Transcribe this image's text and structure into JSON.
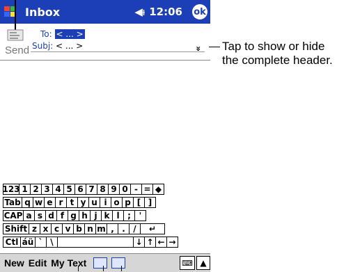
{
  "titlebar": {
    "app_title": "Inbox",
    "speaker_icon": "◀ᵼ",
    "time": "12:06",
    "ok_label": "ok"
  },
  "header": {
    "send_label": "Send",
    "to_label": "To:",
    "to_value": "< ... >",
    "subj_label": "Subj:",
    "subj_value": "< ... >",
    "toggle_glyph": "»"
  },
  "callout": {
    "line1": "Tap to show or hide",
    "line2": "the complete header."
  },
  "keyboard": {
    "rows": [
      [
        "123",
        "1",
        "2",
        "3",
        "4",
        "5",
        "6",
        "7",
        "8",
        "9",
        "0",
        "-",
        "=",
        "◆"
      ],
      [
        "Tab",
        "q",
        "w",
        "e",
        "r",
        "t",
        "y",
        "u",
        "i",
        "o",
        "p",
        "[",
        "]"
      ],
      [
        "CAP",
        "a",
        "s",
        "d",
        "f",
        "g",
        "h",
        "j",
        "k",
        "l",
        ";",
        "'"
      ],
      [
        "Shift",
        "z",
        "x",
        "c",
        "v",
        "b",
        "n",
        "m",
        ",",
        ".",
        "/",
        "↵"
      ],
      [
        "Ctl",
        "áü",
        "`",
        "\\",
        " ",
        "↓",
        "↑",
        "←",
        "→"
      ]
    ]
  },
  "menubar": {
    "new": "New",
    "edit": "Edit",
    "mytext": "My Text",
    "arrow": "▲"
  }
}
